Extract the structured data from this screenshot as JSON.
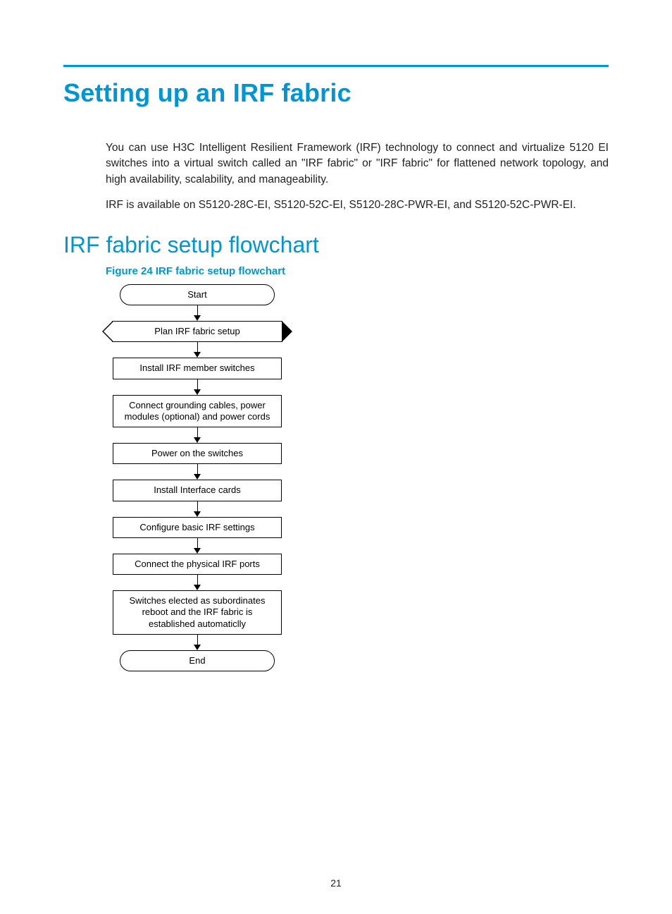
{
  "header": {
    "title": "Setting up an IRF fabric"
  },
  "intro": {
    "p1": "You can use H3C Intelligent Resilient Framework (IRF) technology to connect and virtualize 5120 EI switches into a virtual switch called an \"IRF fabric\" or \"IRF fabric\" for flattened network topology, and high availability, scalability, and manageability.",
    "p2": "IRF is available on S5120-28C-EI, S5120-52C-EI, S5120-28C-PWR-EI, and S5120-52C-PWR-EI."
  },
  "section2": {
    "title": "IRF fabric setup flowchart",
    "figure_caption": "Figure 24 IRF fabric setup flowchart"
  },
  "flowchart": {
    "start": "Start",
    "plan": "Plan IRF fabric setup",
    "install_members": "Install IRF member switches",
    "connect_grounding": "Connect grounding cables, power modules (optional) and power cords",
    "power_on": "Power on the switches",
    "install_interface": "Install Interface cards",
    "configure_basic": "Configure basic IRF settings",
    "connect_physical": "Connect the physical IRF ports",
    "subordinates": "Switches elected as subordinates reboot and the IRF fabric is established automaticlly",
    "end": "End"
  },
  "page_number": "21"
}
